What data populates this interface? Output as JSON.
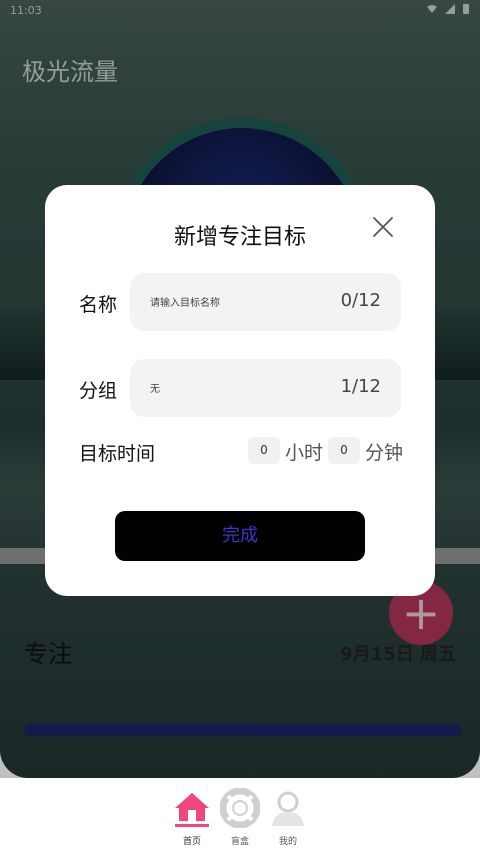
{
  "status_bar": {
    "time": "11:03"
  },
  "app": {
    "title": "极光流量",
    "focus_title": "专注",
    "focus_date": "9月15日 周五",
    "today_focus": "今日已专注：0分钟",
    "fab_symbol": "+"
  },
  "modal": {
    "title": "新增专注目标",
    "name_label": "名称",
    "name_placeholder": "请输入目标名称",
    "name_count": "0/12",
    "group_label": "分组",
    "group_value": "无",
    "group_count": "1/12",
    "time_label": "目标时间",
    "hours_value": "0",
    "hours_unit": "小时",
    "minutes_value": "0",
    "minutes_unit": "分钟",
    "done_label": "完成"
  },
  "bottom_nav": {
    "items": [
      {
        "label": "首页",
        "icon": "home-icon",
        "active": true
      },
      {
        "label": "盲盒",
        "icon": "lifebuoy-icon",
        "active": false
      },
      {
        "label": "我的",
        "icon": "user-icon",
        "active": false
      }
    ]
  },
  "colors": {
    "accent_pink": "#f0487a",
    "done_text": "#3a36c8",
    "fab": "#b0345a"
  }
}
